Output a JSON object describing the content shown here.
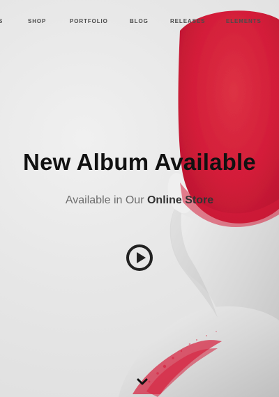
{
  "nav": {
    "items": [
      {
        "label": "S"
      },
      {
        "label": "SHOP"
      },
      {
        "label": "PORTFOLIO"
      },
      {
        "label": "BLOG"
      },
      {
        "label": "RELEASES"
      },
      {
        "label": "ELEMENTS"
      }
    ]
  },
  "hero": {
    "title": "New Album Available",
    "subtitle_prefix": "Available in Our ",
    "subtitle_emphasis": "Online Store"
  },
  "icons": {
    "play": "play-icon",
    "scroll": "chevron-down-icon"
  },
  "colors": {
    "background": "#e6e6e6",
    "accent_red": "#d61d3a",
    "text_dark": "#111111",
    "text_muted": "#6d6d6d",
    "icon_dark": "#222222"
  }
}
